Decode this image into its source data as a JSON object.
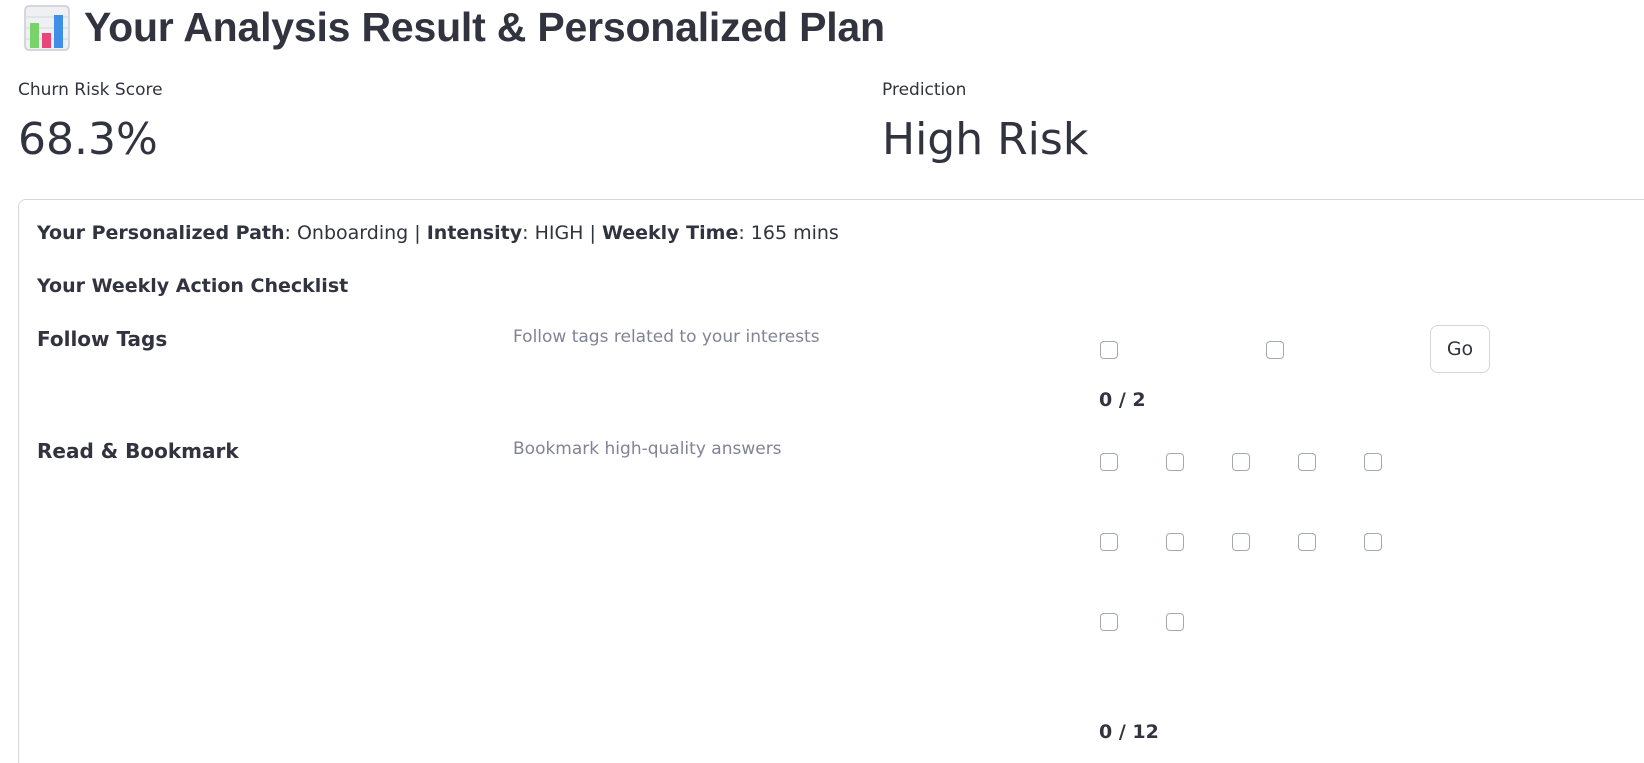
{
  "header": {
    "title": "Your Analysis Result & Personalized Plan",
    "icon": "bar-chart-icon"
  },
  "metrics": {
    "churn": {
      "label": "Churn Risk Score",
      "value": "68.3%"
    },
    "prediction": {
      "label": "Prediction",
      "value": "High Risk"
    }
  },
  "plan": {
    "path_label": "Your Personalized Path",
    "path_value": "Onboarding",
    "intensity_label": "Intensity",
    "intensity_value": "HIGH",
    "time_label": "Weekly Time",
    "time_value": "165 mins",
    "separator": "|"
  },
  "checklist": {
    "title": "Your Weekly Action Checklist",
    "tasks": [
      {
        "name": "Follow Tags",
        "description": "Follow tags related to your interests",
        "progress": "0 / 2",
        "completed": 0,
        "total": 2,
        "button_label": "Go"
      },
      {
        "name": "Read & Bookmark",
        "description": "Bookmark high-quality answers",
        "progress": "0 / 12",
        "completed": 0,
        "total": 12
      }
    ]
  }
}
